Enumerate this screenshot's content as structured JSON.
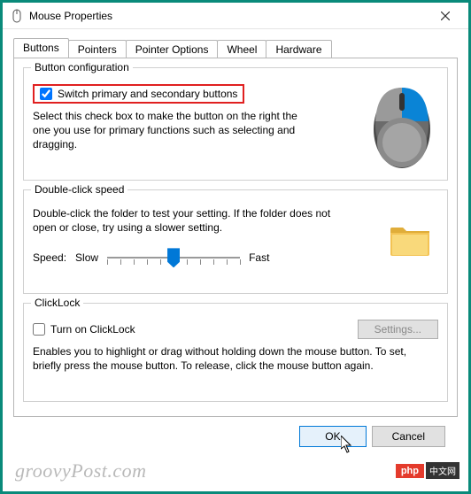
{
  "window": {
    "title": "Mouse Properties"
  },
  "tabs": {
    "t0": "Buttons",
    "t1": "Pointers",
    "t2": "Pointer Options",
    "t3": "Wheel",
    "t4": "Hardware"
  },
  "buttonConfig": {
    "legend": "Button configuration",
    "checkboxLabel": "Switch primary and secondary buttons",
    "desc": "Select this check box to make the button on the right the one you use for primary functions such as selecting and dragging."
  },
  "doubleClick": {
    "legend": "Double-click speed",
    "desc": "Double-click the folder to test your setting. If the folder does not open or close, try using a slower setting.",
    "speedLabel": "Speed:",
    "slow": "Slow",
    "fast": "Fast"
  },
  "clickLock": {
    "legend": "ClickLock",
    "checkboxLabel": "Turn on ClickLock",
    "settingsBtn": "Settings...",
    "desc": "Enables you to highlight or drag without holding down the mouse button. To set, briefly press the mouse button. To release, click the mouse button again."
  },
  "footer": {
    "ok": "OK",
    "cancel": "Cancel"
  },
  "watermark": "groovyPost.com",
  "badge": {
    "php": "php",
    "cn": "中文网"
  }
}
